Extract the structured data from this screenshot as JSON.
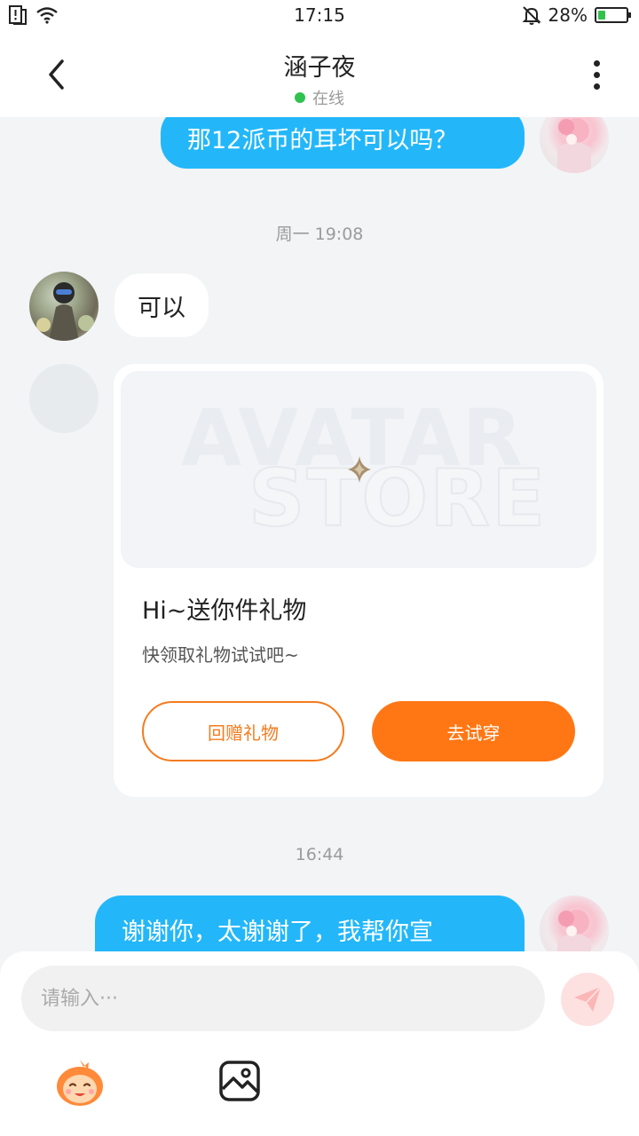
{
  "status_bar": {
    "time": "17:15",
    "battery": "28%",
    "battery_level": 0.28,
    "icons": [
      "sim-alert-icon",
      "wifi-icon",
      "mute-bell-icon",
      "battery-icon"
    ]
  },
  "header": {
    "title": "涵子夜",
    "status": "在线",
    "icons": [
      "back-icon",
      "more-icon"
    ]
  },
  "messages": {
    "msg1": "那12派币的耳坏可以吗？",
    "time1": "周一 19:08",
    "msg2": "可以",
    "gift_card": {
      "banner_line1": "AVATAR",
      "banner_line2": "STORE",
      "title": "Hi~送你件礼物",
      "subtitle": "快领取礼物试试吧~",
      "return_gift_label": "回赠礼物",
      "try_on_label": "去试穿"
    },
    "time2": "16:44",
    "msg3": "谢谢你，太谢谢了，我帮你宣"
  },
  "input_panel": {
    "placeholder": "请输入···",
    "icons": [
      "send-icon",
      "emoji-icon",
      "image-icon"
    ]
  },
  "colors": {
    "accent_blue": "#23b7fa",
    "accent_orange": "#ff7714",
    "online_green": "#2fc24f"
  }
}
